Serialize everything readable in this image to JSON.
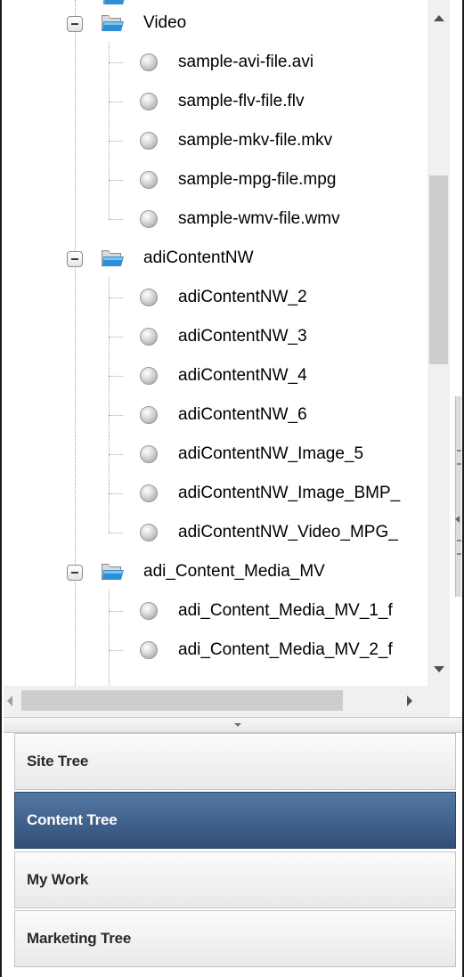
{
  "tree": {
    "rows": [
      {
        "kind": "folder",
        "label": "Video"
      },
      {
        "kind": "item",
        "label": "sample-avi-file.avi"
      },
      {
        "kind": "item",
        "label": "sample-flv-file.flv"
      },
      {
        "kind": "item",
        "label": "sample-mkv-file.mkv"
      },
      {
        "kind": "item",
        "label": "sample-mpg-file.mpg"
      },
      {
        "kind": "item",
        "label": "sample-wmv-file.wmv"
      },
      {
        "kind": "folder",
        "label": "adiContentNW"
      },
      {
        "kind": "item",
        "label": "adiContentNW_2"
      },
      {
        "kind": "item",
        "label": "adiContentNW_3"
      },
      {
        "kind": "item",
        "label": "adiContentNW_4"
      },
      {
        "kind": "item",
        "label": "adiContentNW_6"
      },
      {
        "kind": "item",
        "label": "adiContentNW_Image_5"
      },
      {
        "kind": "item",
        "label": "adiContentNW_Image_BMP_"
      },
      {
        "kind": "item",
        "label": "adiContentNW_Video_MPG_"
      },
      {
        "kind": "folder",
        "label": "adi_Content_Media_MV"
      },
      {
        "kind": "item",
        "label": "adi_Content_Media_MV_1_f"
      },
      {
        "kind": "item",
        "label": "adi_Content_Media_MV_2_f"
      }
    ],
    "folder_icon": "folder-open-icon",
    "item_icon": "gray-bullet-icon",
    "toggle_icon": "collapse-minus-icon"
  },
  "scroll": {
    "vertical_position": 0.26,
    "horizontal_position": 0.0
  },
  "nav": {
    "items": [
      {
        "label": "Site Tree",
        "active": false
      },
      {
        "label": "Content Tree",
        "active": true
      },
      {
        "label": "My Work",
        "active": false
      },
      {
        "label": "Marketing Tree",
        "active": false
      }
    ]
  },
  "colors": {
    "active_nav_top": "#5478a4",
    "active_nav_bottom": "#304f76",
    "folder_blue": "#2f8fd6"
  }
}
